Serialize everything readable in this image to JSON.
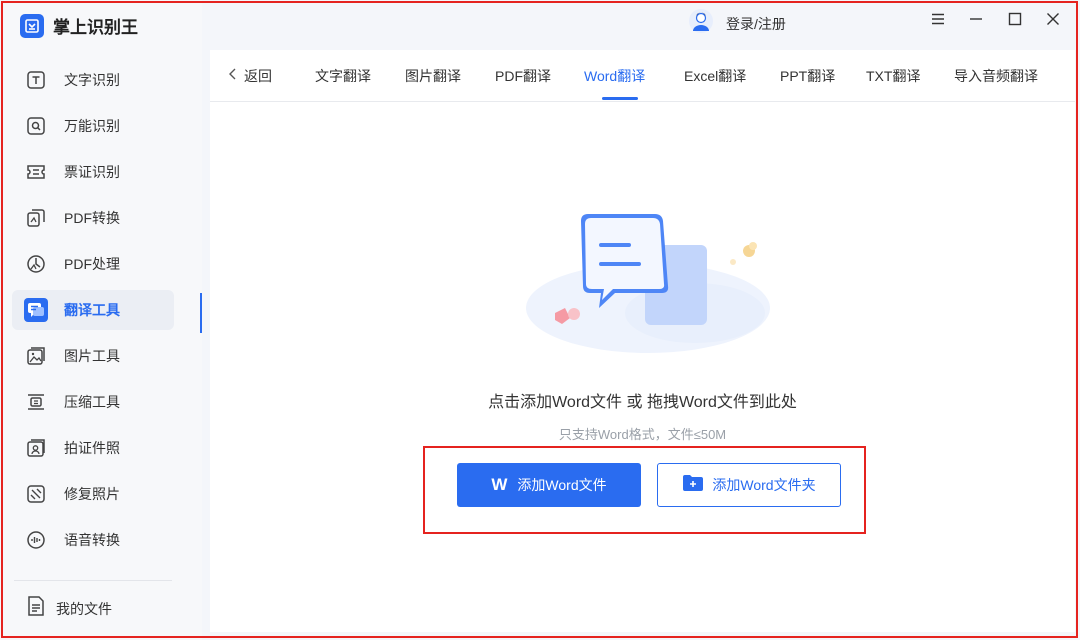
{
  "app": {
    "title": "掌上识别王",
    "accent_color": "#2a6cf0",
    "highlight_color": "#e5231f"
  },
  "titlebar": {
    "login_label": "登录/注册",
    "icons": [
      "menu-icon",
      "minimize-icon",
      "maximize-icon",
      "close-icon"
    ]
  },
  "sidebar": {
    "items": [
      {
        "label": "文字识别",
        "icon": "text-recognition-icon"
      },
      {
        "label": "万能识别",
        "icon": "universal-recognition-icon"
      },
      {
        "label": "票证识别",
        "icon": "ticket-recognition-icon"
      },
      {
        "label": "PDF转换",
        "icon": "pdf-convert-icon"
      },
      {
        "label": "PDF处理",
        "icon": "pdf-process-icon"
      },
      {
        "label": "翻译工具",
        "icon": "translate-icon",
        "active": true
      },
      {
        "label": "图片工具",
        "icon": "image-tool-icon"
      },
      {
        "label": "压缩工具",
        "icon": "compress-icon"
      },
      {
        "label": "拍证件照",
        "icon": "id-photo-icon"
      },
      {
        "label": "修复照片",
        "icon": "photo-repair-icon"
      },
      {
        "label": "语音转换",
        "icon": "voice-convert-icon"
      }
    ],
    "my_files_label": "我的文件"
  },
  "tabs": {
    "back_label": "返回",
    "items": [
      {
        "label": "文字翻译"
      },
      {
        "label": "图片翻译"
      },
      {
        "label": "PDF翻译"
      },
      {
        "label": "Word翻译",
        "active": true
      },
      {
        "label": "Excel翻译"
      },
      {
        "label": "PPT翻译"
      },
      {
        "label": "TXT翻译"
      },
      {
        "label": "导入音频翻译"
      }
    ]
  },
  "upload": {
    "main_text": "点击添加Word文件 或 拖拽Word文件到此处",
    "hint_text": "只支持Word格式，文件≤50M",
    "add_file_mark": "W",
    "add_file_label": "添加Word文件",
    "add_folder_label": "添加Word文件夹"
  }
}
